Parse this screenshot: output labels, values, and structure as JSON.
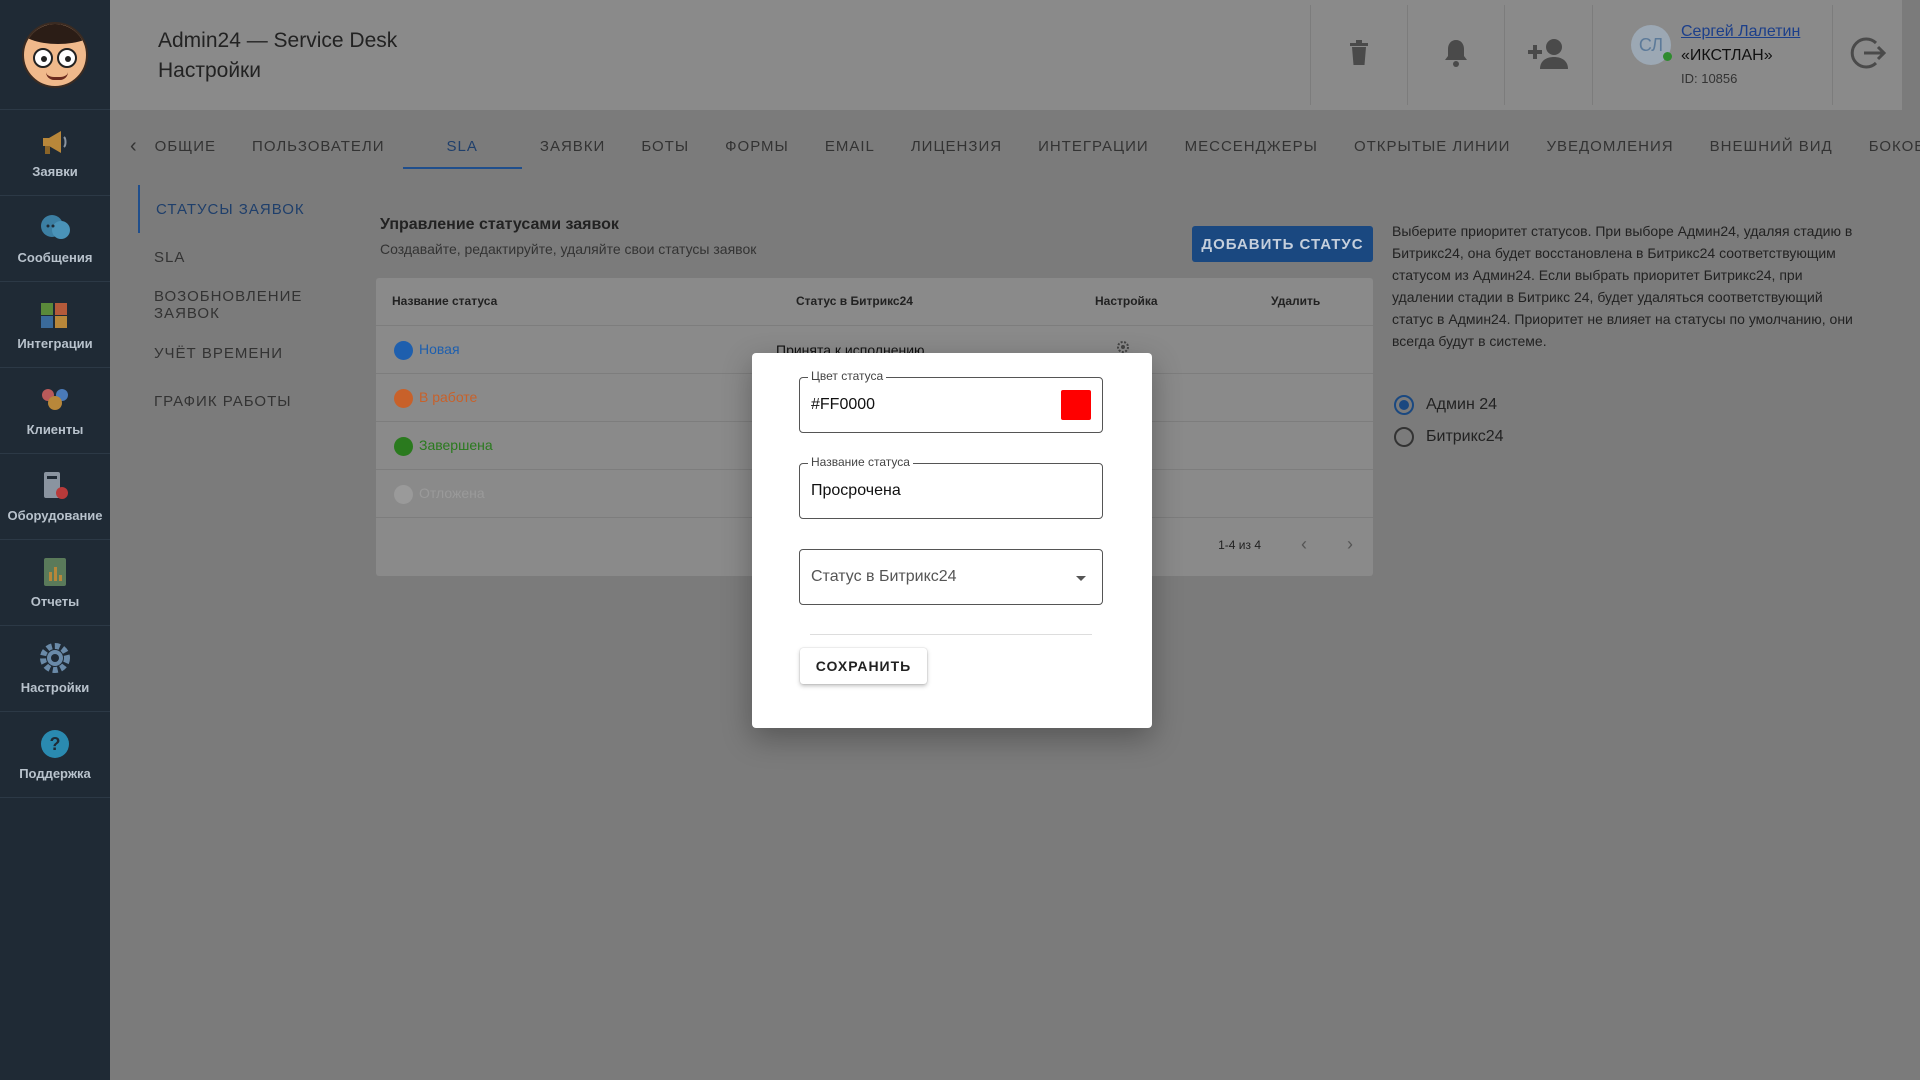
{
  "header": {
    "title_line1": "Admin24 — Service Desk",
    "title_line2": "Настройки",
    "user": {
      "initials": "СЛ",
      "name": "Сергей Лалетин",
      "company": "«ИКСТЛАН»",
      "id": "ID: 10856"
    }
  },
  "sidebar": {
    "items": [
      {
        "label": "Заявки",
        "icon": "megaphone-icon"
      },
      {
        "label": "Сообщения",
        "icon": "chat-bubbles-icon"
      },
      {
        "label": "Интеграции",
        "icon": "puzzle-icon"
      },
      {
        "label": "Клиенты",
        "icon": "clients-icon"
      },
      {
        "label": "Оборудование",
        "icon": "equipment-icon"
      },
      {
        "label": "Отчеты",
        "icon": "report-icon"
      },
      {
        "label": "Настройки",
        "icon": "gear-icon"
      },
      {
        "label": "Поддержка",
        "icon": "help-icon"
      }
    ]
  },
  "tabs": [
    {
      "label": "ОБЩИЕ"
    },
    {
      "label": "ПОЛЬЗОВАТЕЛИ"
    },
    {
      "label": "SLA",
      "active": true
    },
    {
      "label": "ЗАЯВКИ"
    },
    {
      "label": "БОТЫ"
    },
    {
      "label": "ФОРМЫ"
    },
    {
      "label": "EMAIL"
    },
    {
      "label": "ЛИЦЕНЗИЯ"
    },
    {
      "label": "ИНТЕГРАЦИИ"
    },
    {
      "label": "МЕССЕНДЖЕРЫ"
    },
    {
      "label": "ОТКРЫТЫЕ ЛИНИИ"
    },
    {
      "label": "УВЕДОМЛЕНИЯ"
    },
    {
      "label": "ВНЕШНИЙ ВИД"
    },
    {
      "label": "БОКОВОЕ"
    }
  ],
  "submenu": [
    {
      "label": "СТАТУСЫ ЗАЯВОК",
      "active": true
    },
    {
      "label": "SLA"
    },
    {
      "label": "ВОЗОБНОВЛЕНИЕ ЗАЯВОК"
    },
    {
      "label": "УЧЁТ ВРЕМЕНИ"
    },
    {
      "label": "ГРАФИК РАБОТЫ"
    }
  ],
  "content": {
    "title": "Управление статусами заявок",
    "subtitle": "Создавайте, редактируйте, удаляйте свои статусы заявок",
    "add_button": "ДОБАВИТЬ СТАТУС",
    "columns": [
      "Название статуса",
      "Статус в Битрикс24",
      "Настройка",
      "Удалить"
    ],
    "rows": [
      {
        "name": "Новая",
        "color": "#1e5fae",
        "bitrix": "Принята к исполнению"
      },
      {
        "name": "В работе",
        "color": "#c8612a",
        "bitrix": ""
      },
      {
        "name": "Завершена",
        "color": "#2a7a1e",
        "bitrix": ""
      },
      {
        "name": "Отложена",
        "color": "#9a9a9a",
        "bitrix": ""
      }
    ],
    "pagination": "1-4 из 4"
  },
  "hint": "Выберите приоритет статусов. При выборе Админ24, удаляя стадию в Битрикс24, она будет восстановлена в Битрикс24 соответствующим статусом из Админ24. Если выбрать приоритет Битрикс24, при удалении стадии в Битрикс 24, будет удаляться соответствующий статус в Админ24. Приоритет не влияет на статусы по умолчанию, они всегда будут в системе.",
  "priority": {
    "options": [
      "Админ 24",
      "Битрикс24"
    ],
    "selected": "Админ 24"
  },
  "modal": {
    "color_label": "Цвет статуса",
    "color_value": "#FF0000",
    "name_label": "Название статуса",
    "name_value": "Просрочена",
    "bitrix_placeholder": "Статус в Битрикс24",
    "save_button": "СОХРАНИТЬ"
  }
}
